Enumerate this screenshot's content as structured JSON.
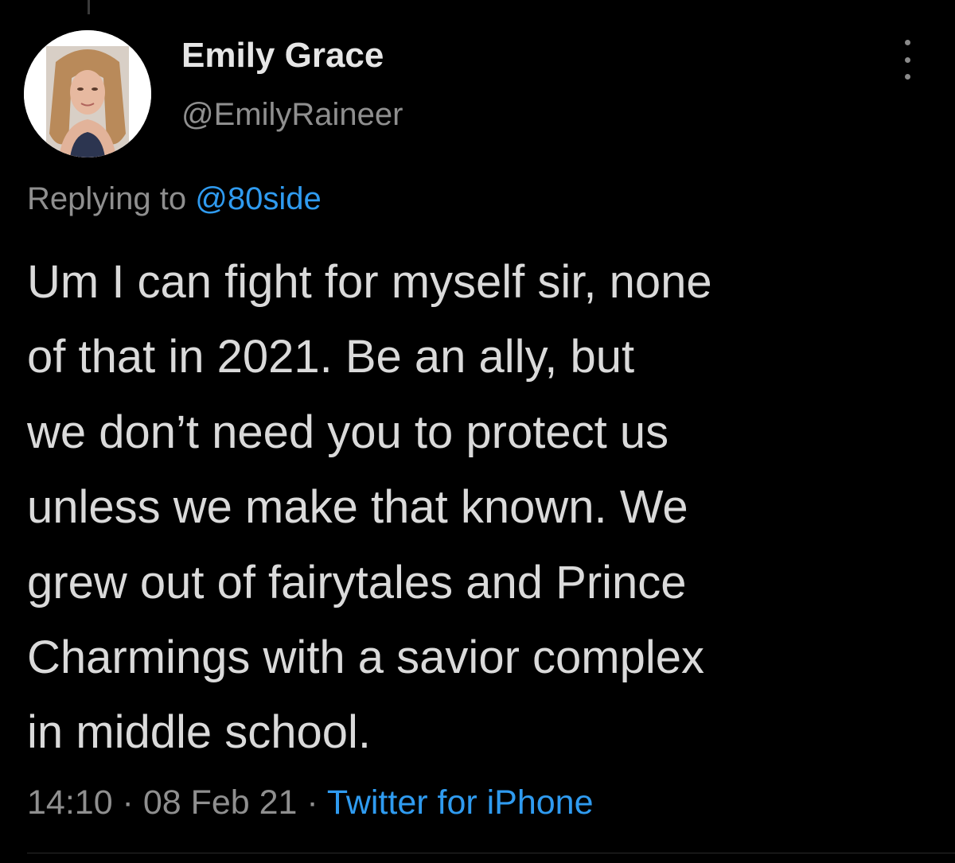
{
  "tweet": {
    "author": {
      "display_name": "Emily Grace",
      "handle": "@EmilyRaineer",
      "avatar": "profile-photo"
    },
    "reply": {
      "prefix": "Replying to ",
      "mention": "@80side"
    },
    "body_lines": [
      "Um I can fight for myself sir, none",
      "of that in 2021. Be an ally, but",
      "we don’t need you to protect us",
      "unless we make that known. We",
      "grew out of fairytales and Prince",
      "Charmings with a savior complex",
      "in middle school."
    ],
    "meta": {
      "time": "14:10",
      "separator": " · ",
      "date": "08 Feb 21",
      "source": "Twitter for iPhone"
    },
    "more_icon": "more-vertical-icon"
  },
  "theme": {
    "background": "#000000",
    "text": "#dadada",
    "secondary_text": "#8f8f8f",
    "accent": "#2f9bf0"
  }
}
